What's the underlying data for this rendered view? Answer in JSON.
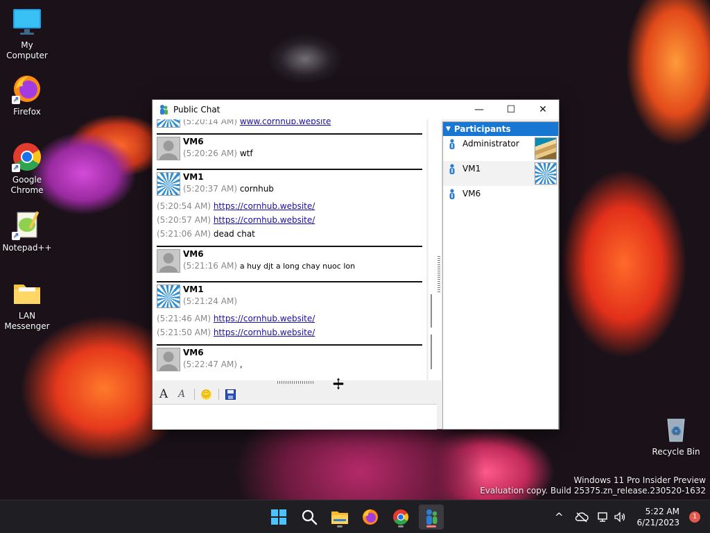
{
  "desktop": {
    "icons": [
      {
        "label": "My Computer"
      },
      {
        "label": "Firefox"
      },
      {
        "label": "Google Chrome"
      },
      {
        "label": "Notepad++"
      },
      {
        "label": "LAN Messenger"
      },
      {
        "label": "Recycle Bin"
      }
    ],
    "watermark": {
      "line1": "Windows 11 Pro Insider Preview",
      "line2": "Evaluation copy. Build 25375.zn_release.230520-1632"
    }
  },
  "window": {
    "title": "Public Chat",
    "controls": {
      "minimize": "—",
      "maximize": "☐",
      "close": "✕"
    },
    "messages": {
      "top_partial": {
        "ts": "(5:20:14 AM)",
        "link": "www.cornhub.website"
      },
      "b1": {
        "sender": "VM6",
        "ts": "(5:20:26 AM)",
        "text": "wtf"
      },
      "b2": {
        "sender": "VM1",
        "l1_ts": "(5:20:37 AM)",
        "l1_text": "cornhub",
        "l2_ts": "(5:20:54 AM)",
        "l2_link": "https://cornhub.website/",
        "l3_ts": "(5:20:57 AM)",
        "l3_link": "https://cornhub.website/",
        "l4_ts": "(5:21:06 AM)",
        "l4_text": "dead chat"
      },
      "b3": {
        "sender": "VM6",
        "ts": "(5:21:16 AM)",
        "text": "a huy djt a long chay nuoc lon"
      },
      "b4": {
        "sender": "VM1",
        "l1_ts": "(5:21:24 AM)",
        "l2_ts": "(5:21:46 AM)",
        "l2_link": "https://cornhub.website/",
        "l3_ts": "(5:21:50 AM)",
        "l3_link": "https://cornhub.website/"
      },
      "b5": {
        "sender": "VM6",
        "ts": "(5:22:47 AM)",
        "text": ","
      }
    },
    "toolbar": {
      "font": "A",
      "font_color": "A",
      "smiley": "☺",
      "save": "💾"
    },
    "participants": {
      "header": "Participants",
      "list": [
        {
          "name": "Administrator"
        },
        {
          "name": "VM1"
        },
        {
          "name": "VM6"
        }
      ]
    }
  },
  "taskbar": {
    "time": "5:22 AM",
    "date": "6/21/2023",
    "notification_count": "1",
    "tray_chevron": "^"
  }
}
